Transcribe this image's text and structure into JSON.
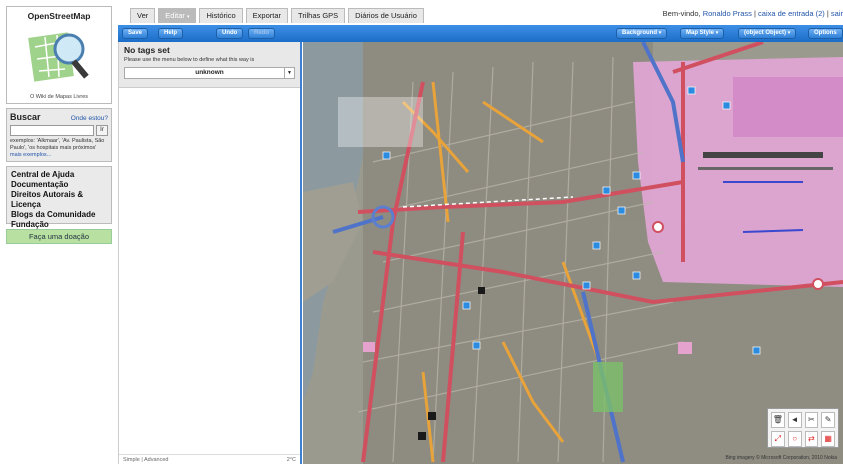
{
  "sidebar": {
    "logo_title": "OpenStreetMap",
    "logo_caption": "O Wiki de Mapas Livres",
    "search": {
      "title": "Buscar",
      "where_link": "Onde estou?",
      "input_value": "",
      "go_label": "Ir",
      "hint": "exemplos: 'Alkmaar', 'Av. Paulista, São Paulo', 'os hospitais mais próximos'",
      "more_examples": "mais exemplos..."
    },
    "links": [
      "Central de Ajuda",
      "Documentação",
      "Direitos Autorais &",
      "Licença",
      "Blogs da Comunidade",
      "Fundação"
    ],
    "donate": "Faça uma doação"
  },
  "tabs": [
    "Ver",
    "Editar",
    "Histórico",
    "Exportar",
    "Trilhas GPS",
    "Diários de Usuário"
  ],
  "active_tab_index": 1,
  "user": {
    "welcome": "Bem-vindo,",
    "name": "Ronaldo Prass",
    "separator": "|",
    "inbox": "caixa de entrada (2)",
    "logout": "sair"
  },
  "toolbar": {
    "save": "Save",
    "help": "Help",
    "undo": "Undo",
    "redo": "Redo",
    "background": "Background",
    "map_style": "Map Style",
    "object": "(object Object)",
    "options": "Options"
  },
  "panel": {
    "title": "No tags set",
    "subtitle": "Please use the menu below to define what this way is",
    "select_value": "unknown",
    "footer_left": "Simple",
    "footer_mid": "Advanced",
    "footer_right": "2°C"
  },
  "attribution": "Bing imagery © Microsoft Corporation, 2010 Nokia",
  "colors": {
    "toolbar": "#1c6dc7",
    "panel_border": "#3d7fd0",
    "donate": "#b8e0a0",
    "map_bg": "#9b9a8e",
    "road_orange": "#e8a33a",
    "road_red": "#d05060",
    "airport": "#e2a6d6",
    "water": "#8c9aa0"
  }
}
